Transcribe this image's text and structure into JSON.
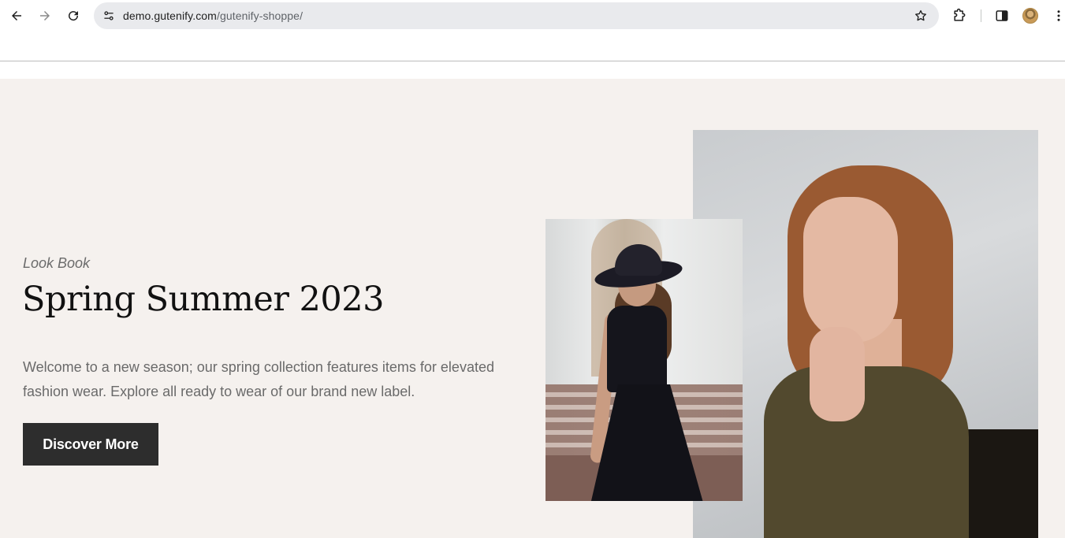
{
  "browser": {
    "url_host": "demo.gutenify.com",
    "url_path": "/gutenify-shoppe/",
    "icons": {
      "back": "back-arrow-icon",
      "forward": "forward-arrow-icon",
      "reload": "reload-icon",
      "site_info": "tune-icon",
      "bookmark": "star-icon",
      "extensions": "puzzle-icon",
      "side_panel": "side-panel-icon",
      "menu": "kebab-menu-icon"
    }
  },
  "hero": {
    "eyebrow": "Look Book",
    "title": "Spring Summer 2023",
    "description": "Welcome to a new season; our spring collection features items for elevated fashion wear. Explore all ready to wear of our brand new label.",
    "cta_label": "Discover More",
    "background_color": "#f5f1ee",
    "button_color": "#2d2d2d"
  }
}
